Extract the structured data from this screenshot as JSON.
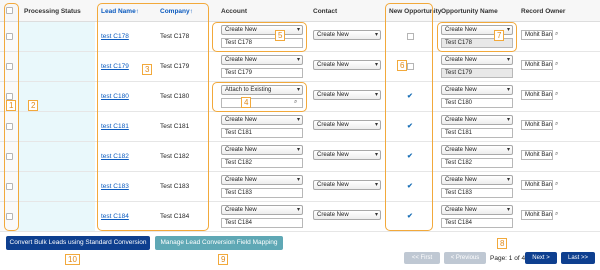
{
  "headers": {
    "processing_status": "Processing Status",
    "lead_name": "Lead Name↑",
    "company": "Company↑",
    "account": "Account",
    "contact": "Contact",
    "new_opportunity": "New Opportunity",
    "opportunity_name": "Opportunity Name",
    "record_owner": "Record Owner"
  },
  "rows": [
    {
      "lead": "test C178",
      "company": "Test C178",
      "account_select": "Create New",
      "account_text": "Test C178",
      "contact": "Create New",
      "new_opp": false,
      "opp_select": "Create New",
      "opp_text": "Test C178",
      "owner": "Mohit Ban"
    },
    {
      "lead": "test C179",
      "company": "Test C179",
      "account_select": "Create New",
      "account_text": "Test C179",
      "contact": "Create New",
      "new_opp": false,
      "opp_select": "Create New",
      "opp_text": "Test C179",
      "owner": "Mohit Ban"
    },
    {
      "lead": "test C180",
      "company": "Test C180",
      "account_select": "Attach to Existing",
      "account_text": "",
      "contact": "Create New",
      "new_opp": true,
      "opp_select": "Create New",
      "opp_text": "Test C180",
      "owner": "Mohit Ban"
    },
    {
      "lead": "test C181",
      "company": "Test C181",
      "account_select": "Create New",
      "account_text": "Test C181",
      "contact": "Create New",
      "new_opp": true,
      "opp_select": "Create New",
      "opp_text": "Test C181",
      "owner": "Mohit Ban"
    },
    {
      "lead": "test C182",
      "company": "Test C182",
      "account_select": "Create New",
      "account_text": "Test C182",
      "contact": "Create New",
      "new_opp": true,
      "opp_select": "Create New",
      "opp_text": "Test C182",
      "owner": "Mohit Ban"
    },
    {
      "lead": "test C183",
      "company": "Test C183",
      "account_select": "Create New",
      "account_text": "Test C183",
      "contact": "Create New",
      "new_opp": true,
      "opp_select": "Create New",
      "opp_text": "Test C183",
      "owner": "Mohit Ban"
    },
    {
      "lead": "test C184",
      "company": "Test C184",
      "account_select": "Create New",
      "account_text": "Test C184",
      "contact": "Create New",
      "new_opp": true,
      "opp_select": "Create New",
      "opp_text": "Test C184",
      "owner": "Mohit Ban"
    }
  ],
  "buttons": {
    "convert_bulk": "Convert Bulk Leads using Standard Conversion",
    "manage_mapping": "Manage Lead Conversion Field Mapping"
  },
  "pagination": {
    "first": "<< First",
    "previous": "< Previous",
    "page_info": "Page: 1 of 4",
    "next": "Next >",
    "last": "Last >>"
  },
  "callouts": [
    "1",
    "2",
    "3",
    "4",
    "5",
    "6",
    "7",
    "8",
    "9",
    "10"
  ],
  "colors": {
    "callout_orange": "#f2a93b",
    "link_blue": "#0b5bbf",
    "primary_button": "#0e3f8f",
    "secondary_button": "#5fa8b5",
    "status_bg": "#e9f8fb"
  }
}
